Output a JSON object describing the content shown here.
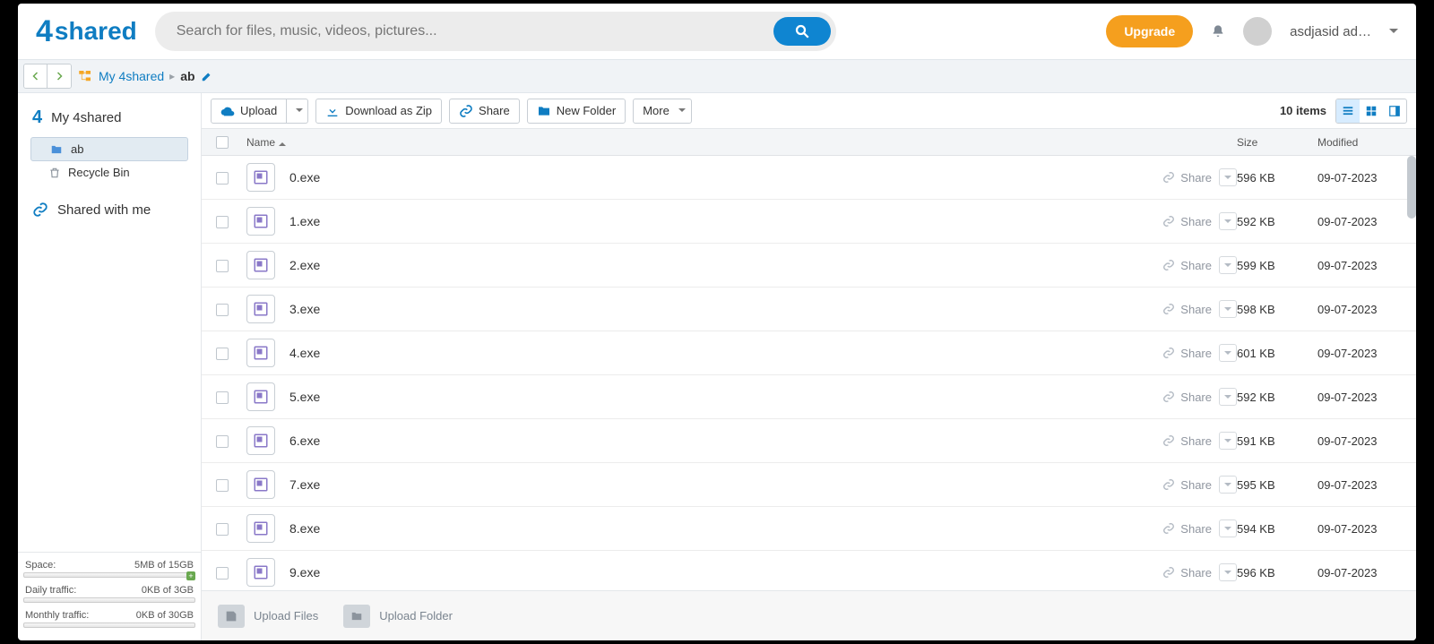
{
  "header": {
    "logo_text": "shared",
    "search_placeholder": "Search for files, music, videos, pictures...",
    "upgrade": "Upgrade",
    "user": "asdjasid ad…"
  },
  "breadcrumb": {
    "root": "My 4shared",
    "current": "ab"
  },
  "sidebar": {
    "home": "My 4shared",
    "items": [
      {
        "label": "ab",
        "selected": true
      },
      {
        "label": "Recycle Bin",
        "selected": false
      }
    ],
    "shared": "Shared with me",
    "stats": {
      "space_label": "Space:",
      "space_value": "5MB of 15GB",
      "daily_label": "Daily traffic:",
      "daily_value": "0KB of 3GB",
      "monthly_label": "Monthly traffic:",
      "monthly_value": "0KB of 30GB"
    }
  },
  "toolbar": {
    "upload": "Upload",
    "download_zip": "Download as Zip",
    "share": "Share",
    "new_folder": "New Folder",
    "more": "More",
    "items_count": "10 items"
  },
  "columns": {
    "name": "Name",
    "size": "Size",
    "modified": "Modified"
  },
  "share_label": "Share",
  "files": [
    {
      "name": "0.exe",
      "size": "596 KB",
      "modified": "09-07-2023"
    },
    {
      "name": "1.exe",
      "size": "592 KB",
      "modified": "09-07-2023"
    },
    {
      "name": "2.exe",
      "size": "599 KB",
      "modified": "09-07-2023"
    },
    {
      "name": "3.exe",
      "size": "598 KB",
      "modified": "09-07-2023"
    },
    {
      "name": "4.exe",
      "size": "601 KB",
      "modified": "09-07-2023"
    },
    {
      "name": "5.exe",
      "size": "592 KB",
      "modified": "09-07-2023"
    },
    {
      "name": "6.exe",
      "size": "591 KB",
      "modified": "09-07-2023"
    },
    {
      "name": "7.exe",
      "size": "595 KB",
      "modified": "09-07-2023"
    },
    {
      "name": "8.exe",
      "size": "594 KB",
      "modified": "09-07-2023"
    },
    {
      "name": "9.exe",
      "size": "596 KB",
      "modified": "09-07-2023"
    }
  ],
  "footer": {
    "upload_files": "Upload Files",
    "upload_folder": "Upload Folder"
  }
}
